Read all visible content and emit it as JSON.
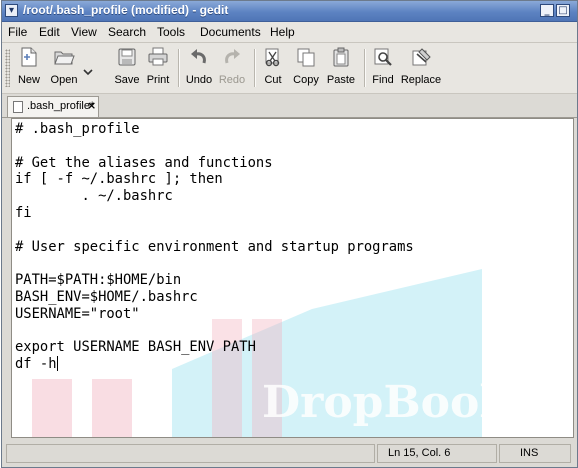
{
  "window": {
    "title": "/root/.bash_profile (modified) - gedit",
    "min_label": "_",
    "max_label": "□",
    "close_label": "×"
  },
  "menu": [
    "File",
    "Edit",
    "View",
    "Search",
    "Tools",
    "Documents",
    "Help"
  ],
  "toolbar": {
    "new": "New",
    "open": "Open",
    "save": "Save",
    "print": "Print",
    "undo": "Undo",
    "redo": "Redo",
    "cut": "Cut",
    "copy": "Copy",
    "paste": "Paste",
    "find": "Find",
    "replace": "Replace"
  },
  "tab": {
    "label": ".bash_profile*",
    "close": "×"
  },
  "editor": {
    "lines": [
      "# .bash_profile",
      "",
      "# Get the aliases and functions",
      "if [ -f ~/.bashrc ]; then",
      "        . ~/.bashrc",
      "fi",
      "",
      "# User specific environment and startup programs",
      "",
      "PATH=$PATH:$HOME/bin",
      "BASH_ENV=$HOME/.bashrc",
      "USERNAME=\"root\"",
      "",
      "export USERNAME BASH_ENV PATH",
      "df -h"
    ],
    "watermark_text": "DropBooks",
    "watermark_colors": {
      "blue": "#aee8f2",
      "red": "#f2b4c0",
      "text": "#ffffff"
    }
  },
  "status": {
    "position": "Ln 15, Col. 6",
    "mode": "INS"
  }
}
